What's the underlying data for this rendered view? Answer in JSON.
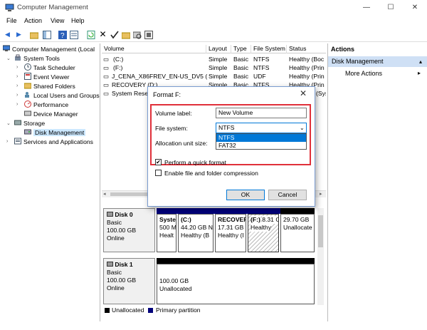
{
  "window": {
    "title": "Computer Management",
    "minimize": "—",
    "maximize": "☐",
    "close": "✕"
  },
  "menu": [
    "File",
    "Action",
    "View",
    "Help"
  ],
  "tree": {
    "root": "Computer Management (Local",
    "system_tools": "System Tools",
    "task_scheduler": "Task Scheduler",
    "event_viewer": "Event Viewer",
    "shared_folders": "Shared Folders",
    "local_users": "Local Users and Groups",
    "performance": "Performance",
    "device_manager": "Device Manager",
    "storage": "Storage",
    "disk_management": "Disk Management",
    "services": "Services and Applications"
  },
  "volumes": {
    "headers": [
      "Volume",
      "Layout",
      "Type",
      "File System",
      "Status"
    ],
    "rows": [
      {
        "name": "(C:)",
        "layout": "Simple",
        "type": "Basic",
        "fs": "NTFS",
        "status": "Healthy (Boc"
      },
      {
        "name": "(F:)",
        "layout": "Simple",
        "type": "Basic",
        "fs": "NTFS",
        "status": "Healthy (Prin"
      },
      {
        "name": "J_CENA_X86FREV_EN-US_DV5 (G:)",
        "layout": "Simple",
        "type": "Basic",
        "fs": "UDF",
        "status": "Healthy (Prin"
      },
      {
        "name": "RECOVERY (D:)",
        "layout": "Simple",
        "type": "Basic",
        "fs": "NTFS",
        "status": "Healthy (Prin"
      },
      {
        "name": "System Reser",
        "layout": "",
        "type": "",
        "fs": "",
        "status": "(Sys"
      }
    ]
  },
  "actions": {
    "title": "Actions",
    "section": "Disk Management",
    "more": "More Actions"
  },
  "disks": [
    {
      "name": "Disk 0",
      "type": "Basic",
      "size": "100.00 GB",
      "state": "Online",
      "partitions": [
        {
          "line1": "Syste",
          "line2": "500 M",
          "line3": "Healt"
        },
        {
          "line1": "(C:)",
          "line2": "44.20 GB N",
          "line3": "Healthy (B"
        },
        {
          "line1": "RECOVER",
          "line2": "17.31 GB",
          "line3": "Healthy (I"
        },
        {
          "line1": "(F:)",
          "line2": "8.31 GB I",
          "line3": "Healthy"
        },
        {
          "line1": "",
          "line2": "29.70 GB",
          "line3": "Unallocate"
        }
      ]
    },
    {
      "name": "Disk 1",
      "type": "Basic",
      "size": "100.00 GB",
      "state": "Online",
      "partitions": [
        {
          "line1": "",
          "line2": "100.00 GB",
          "line3": "Unallocated"
        }
      ]
    }
  ],
  "legend": {
    "unallocated": "Unallocated",
    "primary": "Primary partition"
  },
  "dialog": {
    "title": "Format F:",
    "close": "✕",
    "volume_label_caption": "Volume label:",
    "volume_label_value": "New Volume",
    "file_system_caption": "File system:",
    "file_system_value": "NTFS",
    "file_system_options": [
      "NTFS",
      "FAT32"
    ],
    "allocation_caption": "Allocation unit size:",
    "quick_format_label": "Perform a quick format",
    "quick_format_checked": true,
    "compression_label": "Enable file and folder compression",
    "compression_checked": false,
    "ok_label": "OK",
    "cancel_label": "Cancel"
  },
  "colors": {
    "primary_partition_bar": "#00007a",
    "unallocated_bar": "#000000",
    "highlight_red": "#e0303a",
    "selection_blue": "#0078d7"
  }
}
